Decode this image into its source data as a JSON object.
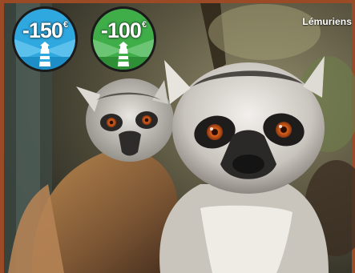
{
  "photo": {
    "caption": "Lémuriens",
    "border_color": "#9a4a24"
  },
  "badges": [
    {
      "amount": "-150",
      "currency": "€",
      "color": "#2fa8e0",
      "icon": "lighthouse-icon"
    },
    {
      "amount": "-100",
      "currency": "€",
      "color": "#3fae49",
      "icon": "lighthouse-icon"
    }
  ]
}
